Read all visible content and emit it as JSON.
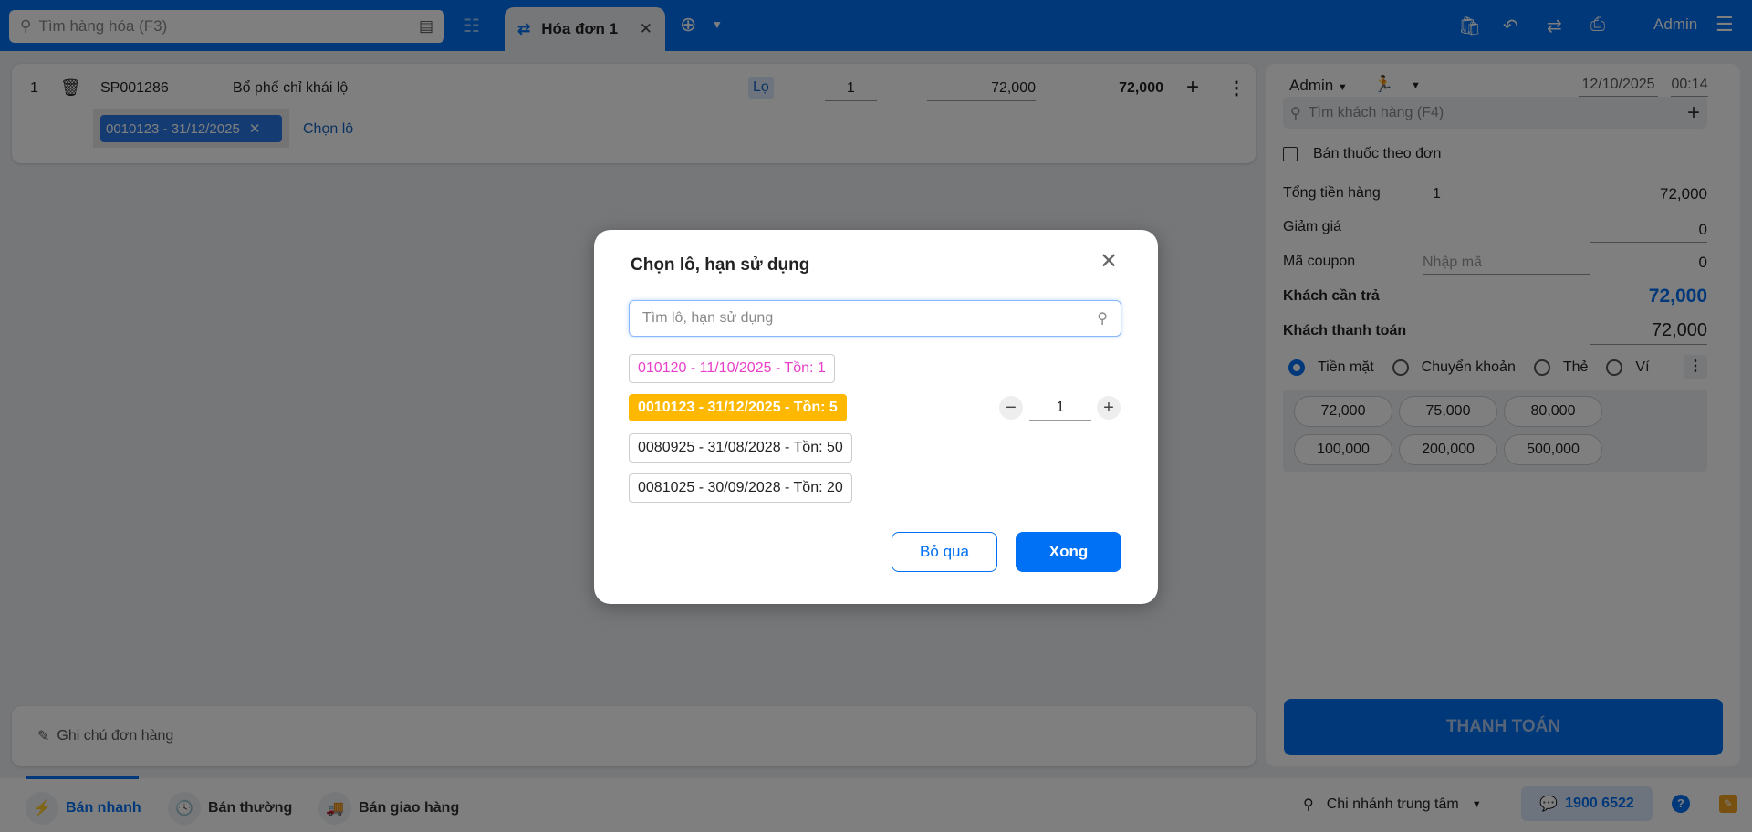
{
  "header": {
    "search_placeholder": "Tìm hàng hóa (F3)",
    "tab_label": "Hóa đơn 1",
    "user": "Admin"
  },
  "order": {
    "index": "1",
    "code": "SP001286",
    "name": "Bổ phế chỉ khái lộ",
    "unit": "Lọ",
    "qty": "1",
    "price": "72,000",
    "total": "72,000",
    "lot_chip": "0010123 - 31/12/2025",
    "choose_lot": "Chọn lô"
  },
  "note": {
    "placeholder": "Ghi chú đơn hàng"
  },
  "panel": {
    "seller": "Admin",
    "date": "12/10/2025",
    "time": "00:14",
    "customer_placeholder": "Tìm khách hàng (F4)",
    "prescription": "Bán thuốc theo đơn",
    "subtotal_label": "Tổng tiền hàng",
    "subtotal_count": "1",
    "subtotal": "72,000",
    "discount_label": "Giảm giá",
    "discount": "0",
    "coupon_label": "Mã coupon",
    "coupon_placeholder": "Nhập mã",
    "coupon": "0",
    "due_label": "Khách cần trả",
    "due": "72,000",
    "paid_label": "Khách thanh toán",
    "paid": "72,000",
    "methods": [
      "Tiền mặt",
      "Chuyển khoản",
      "Thẻ",
      "Ví"
    ],
    "quick": [
      "72,000",
      "75,000",
      "80,000",
      "100,000",
      "200,000",
      "500,000"
    ],
    "pay_button": "THANH TOÁN"
  },
  "bottom": {
    "modes": [
      "Bán nhanh",
      "Bán thường",
      "Bán giao hàng"
    ],
    "branch": "Chi nhánh trung tâm",
    "hotline": "1900 6522"
  },
  "modal": {
    "title": "Chọn lô, hạn sử dụng",
    "search_placeholder": "Tìm lô, hạn sử dụng",
    "lots": [
      "010120 - 11/10/2025 - Tồn: 1",
      "0010123 - 31/12/2025 - Tồn: 5",
      "0080925 - 31/08/2028 - Tồn: 50",
      "0081025 - 30/09/2028 - Tồn: 20"
    ],
    "selected_qty": "1",
    "cancel": "Bỏ qua",
    "done": "Xong"
  },
  "colors": {
    "brand": "#0070f4",
    "selected_lot": "#ffb800",
    "expiring_lot": "#e83ec8"
  }
}
